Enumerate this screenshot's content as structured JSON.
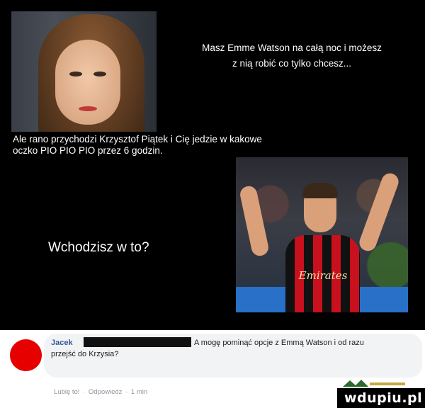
{
  "meme": {
    "caption_top_line1": "Masz Emme Watson na całą noc i możesz",
    "caption_top_line2": "z nią robić co tylko chcesz...",
    "caption_mid_line1": "Ale rano przychodzi Krzysztof Piątek i Cię jedzie w kakowe",
    "caption_mid_line2": "oczko PIO PIO PIO przez 6 godzin.",
    "question": "Wchodzisz w to?",
    "jersey_sponsor": "Emirates"
  },
  "comment": {
    "author": "Jacek",
    "text_line1": "A mogę pominąć opcje z Emmą Watson i od razu",
    "text_line2": "przejść do Krzysia?",
    "like_label": "Lubię to!",
    "reply_label": "Odpowiedz",
    "separator": "·",
    "time": "1 min",
    "avatar_color": "#e60000"
  },
  "watermark": {
    "text": "wdupiu.pl"
  }
}
